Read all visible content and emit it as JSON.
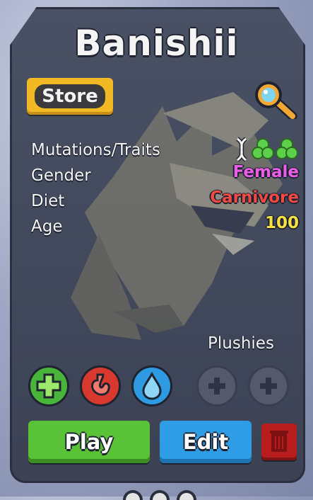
{
  "dragon": {
    "name": "Banishii"
  },
  "store": {
    "label": "Store"
  },
  "stats": [
    {
      "label": "Mutations/Traits",
      "value": ""
    },
    {
      "label": "Gender",
      "value": "Female",
      "color": "#ec5ee6"
    },
    {
      "label": "Diet",
      "value": "Carnivore",
      "color": "#f04a42"
    },
    {
      "label": "Age",
      "value": "100",
      "color": "#f6e142"
    }
  ],
  "traits": {
    "icons": [
      "dna-icon",
      "clover-icon",
      "clover-icon"
    ],
    "icon_colors": {
      "dna": "#f2f2f2",
      "clover": "#5cd04a"
    }
  },
  "plushies": {
    "label": "Plushies",
    "slots": [
      "add-plushie-slot-1",
      "add-plushie-slot-2"
    ]
  },
  "status_buttons": [
    {
      "name": "heal-button",
      "color": "#49b43a",
      "icon": "plus-icon"
    },
    {
      "name": "hunger-button",
      "color": "#d9382f",
      "icon": "stomach-icon"
    },
    {
      "name": "thirst-button",
      "color": "#2d9ae2",
      "icon": "water-drop-icon"
    }
  ],
  "actions": {
    "play_label": "Play",
    "edit_label": "Edit",
    "delete_icon": "trash-icon"
  },
  "colors": {
    "store": "#f2b924",
    "play": "#5ac236",
    "edit": "#2f9de6",
    "delete": "#b81d1d",
    "card": "#454b5e"
  }
}
